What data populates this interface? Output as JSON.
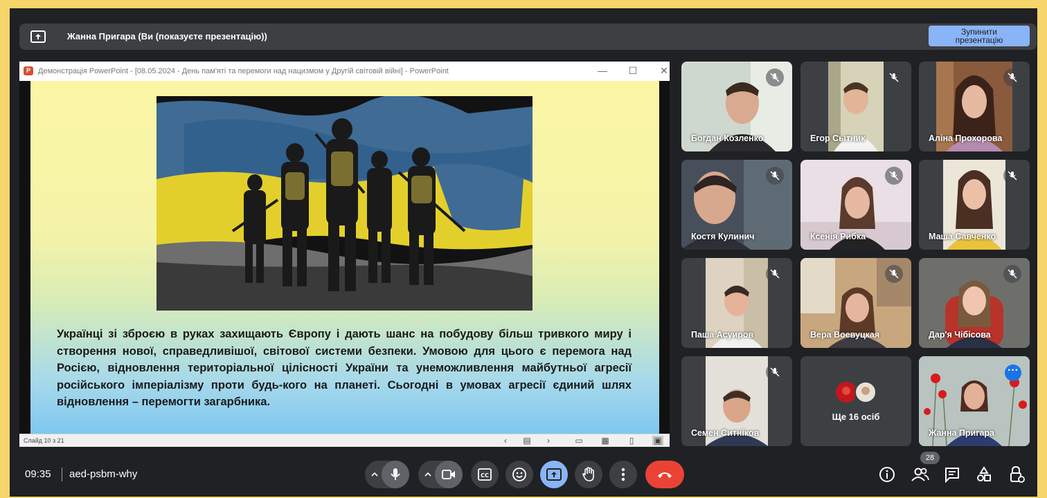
{
  "presenting_bar": {
    "text": "Жанна Пригара (Ви (показуєте презентацію))",
    "stop_line1": "Зупинити",
    "stop_line2": "презентацію"
  },
  "powerpoint": {
    "title": "Демонстрація PowerPoint - [08.05.2024 - День пам'яті та перемоги над нацизмом у Другій світовій війні] - PowerPoint",
    "logo_letter": "P",
    "slide_text": "Українці зі зброєю в руках захищають Європу і дають шанс на побудову більш тривкого миру і створення нової, справедливішої, світової системи безпеки. Умовою для цього є перемога над Росією, відновлення територіальної цілісності України та унеможливлення майбутньої агресії російського імперіалізму проти будь-кого на планеті. Сьогодні в умовах агресії єдиний шлях відновлення – перемогти загарбника.",
    "slide_indicator": "Слайд 10 з 21"
  },
  "participants": [
    {
      "name": "Богдан Козленко"
    },
    {
      "name": "Егор Сытник"
    },
    {
      "name": "Аліна Прохорова"
    },
    {
      "name": "Костя Кулинич"
    },
    {
      "name": "Ксенія Рибка"
    },
    {
      "name": "Маша Савченко"
    },
    {
      "name": "Паша Асуиров"
    },
    {
      "name": "Вера Воевуцкая"
    },
    {
      "name": "Дар'я Чібісова"
    },
    {
      "name": "Семен Ситніков"
    }
  ],
  "others": {
    "label": "Ще 16 осіб"
  },
  "self_tile": {
    "name": "Жанна Пригара"
  },
  "bottom": {
    "time": "09:35",
    "meeting_code": "aed-psbm-why",
    "participants_count": "28"
  },
  "colors": {
    "background": "#202124",
    "frame": "#f6d66a",
    "accent": "#8ab4f8",
    "end_call": "#ea4335"
  }
}
